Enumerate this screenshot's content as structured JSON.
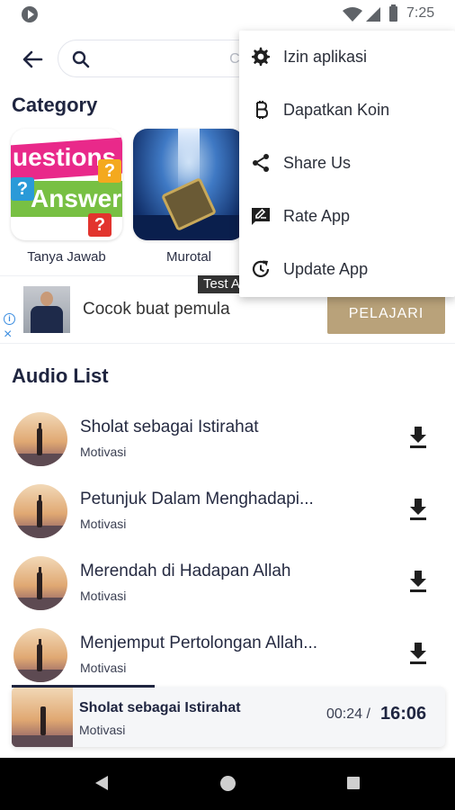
{
  "status_bar": {
    "time": "7:25"
  },
  "search": {
    "placeholder": "Cari Audio",
    "value": ""
  },
  "category": {
    "title": "Category",
    "items": [
      {
        "label": "Tanya Jawab",
        "thumb_text_1": "uestions",
        "thumb_text_2": "Answers"
      },
      {
        "label": "Murotal"
      }
    ]
  },
  "ad": {
    "badge": "Test Ad",
    "text": "Cocok buat pemula",
    "cta": "PELAJARI"
  },
  "audio_list": {
    "title": "Audio List",
    "items": [
      {
        "title": "Sholat sebagai Istirahat",
        "category": "Motivasi"
      },
      {
        "title": "Petunjuk Dalam Menghadapi...",
        "category": "Motivasi"
      },
      {
        "title": "Merendah di Hadapan Allah",
        "category": "Motivasi"
      },
      {
        "title": "Menjemput Pertolongan Allah...",
        "category": "Motivasi"
      }
    ]
  },
  "player": {
    "title": "Sholat sebagai Istirahat",
    "category": "Motivasi",
    "current_time": "00:24 /",
    "duration": "16:06",
    "progress": 0.33
  },
  "menu": {
    "items": [
      {
        "label": "Izin aplikasi",
        "icon": "gear-icon"
      },
      {
        "label": "Dapatkan Koin",
        "icon": "bitcoin-icon"
      },
      {
        "label": "Share Us",
        "icon": "share-icon"
      },
      {
        "label": "Rate App",
        "icon": "rate-icon"
      },
      {
        "label": "Update App",
        "icon": "update-icon"
      }
    ]
  },
  "colors": {
    "primary_text": "#1f2540",
    "cta": "#b9a27a",
    "nav_bar": "#000000"
  }
}
